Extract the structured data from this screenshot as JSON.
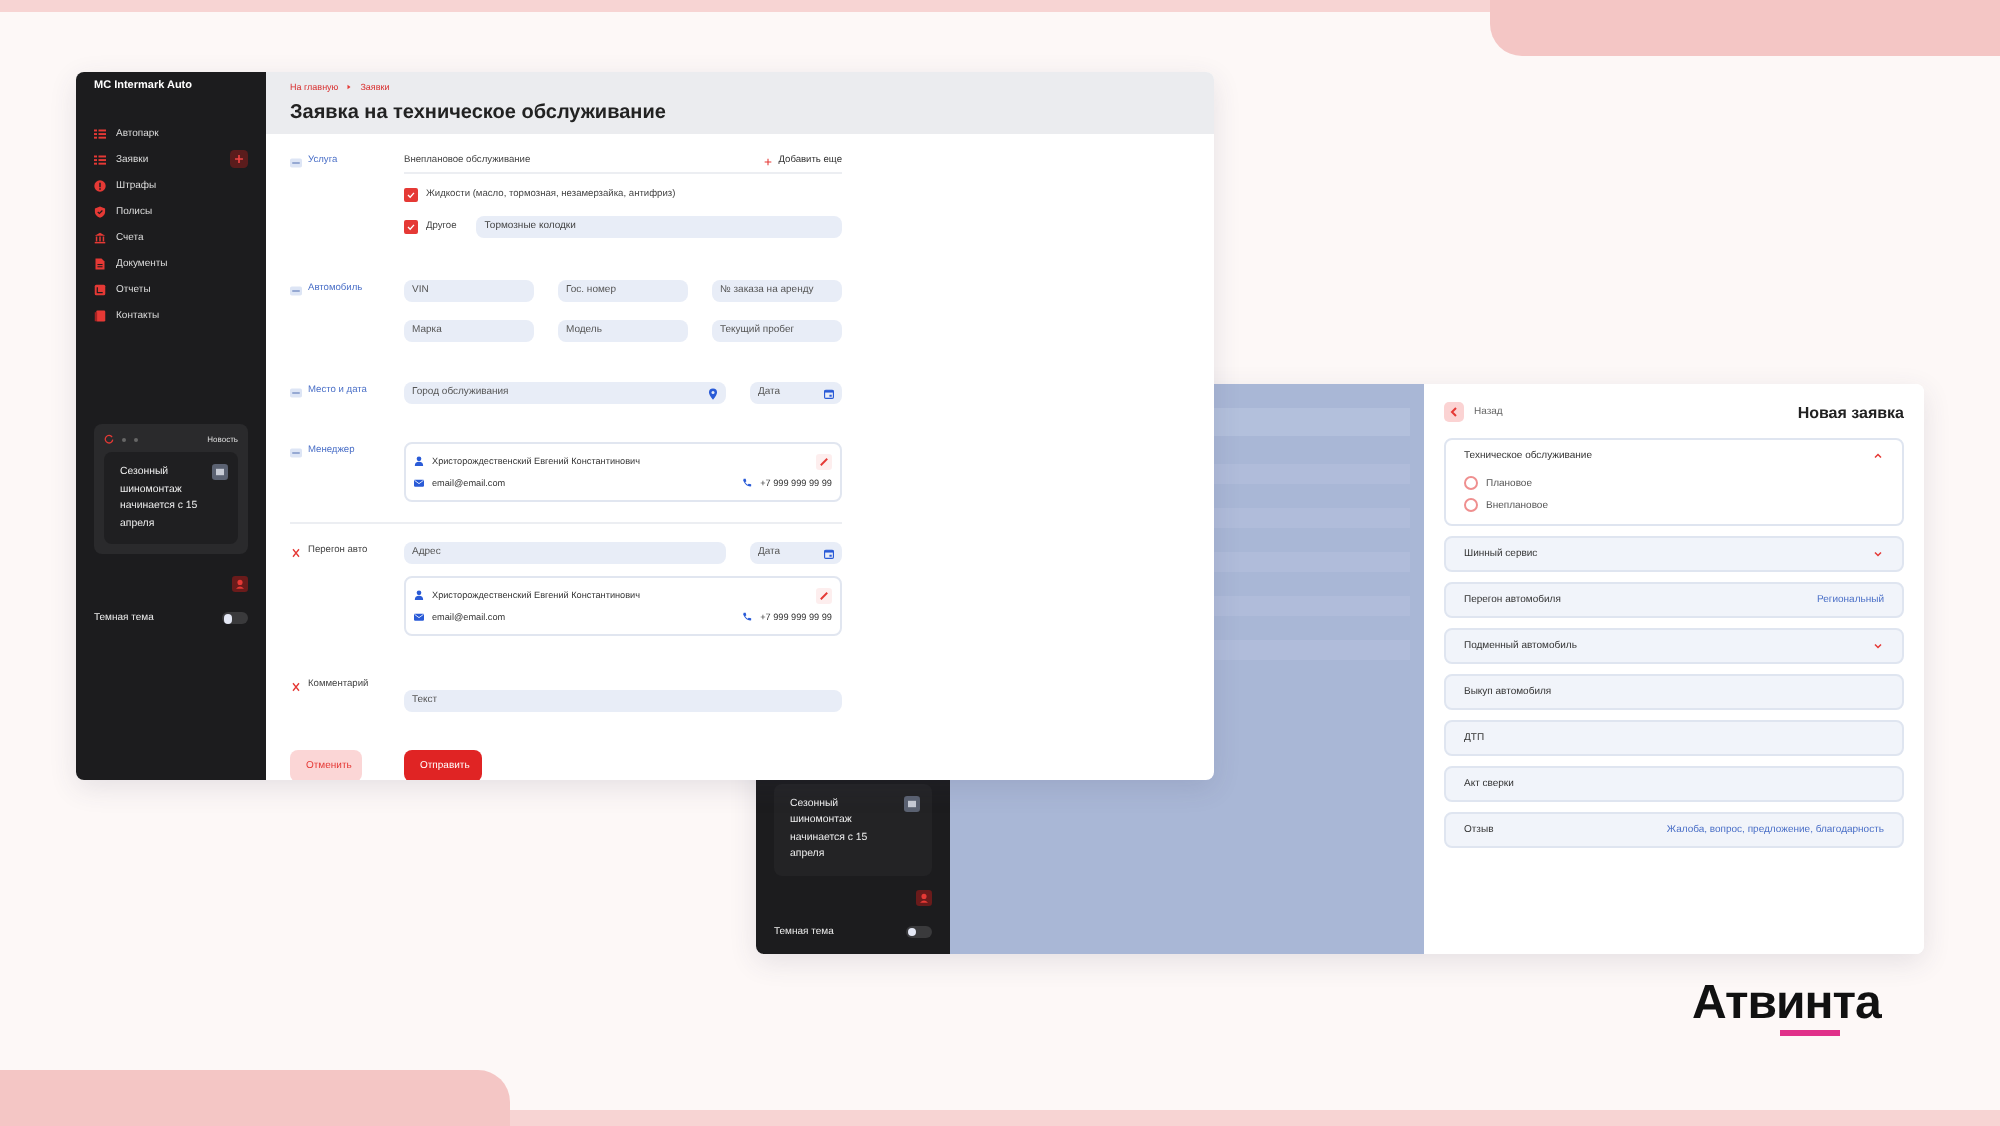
{
  "front_window": {
    "sidebar": {
      "brand": "MC Intermark Auto",
      "items": [
        {
          "label": "Автопарк"
        },
        {
          "label": "Заявки"
        },
        {
          "label": "Штрафы"
        },
        {
          "label": "Полисы"
        },
        {
          "label": "Счета"
        },
        {
          "label": "Документы"
        },
        {
          "label": "Отчеты"
        },
        {
          "label": "Контакты"
        }
      ],
      "news": {
        "label": "Новость",
        "text": "Сезонный шиномонтаж начинается с 15 апреля"
      },
      "dark_theme": {
        "label": "Темная тема",
        "on": false
      }
    },
    "breadcrumbs": [
      "На главную",
      "Заявки"
    ],
    "title": "Заявка на техническое обслуживание",
    "service": {
      "label": "Услуга",
      "kind": "fixed",
      "value": "Внеплановое обслуживание",
      "add": "Добавить еще",
      "options": [
        {
          "label": "Жидкости (масло, тормозная, незамерзайка, антифриз)",
          "checked": true
        },
        {
          "label": "Другое",
          "checked": true,
          "value": "Тормозные колодки"
        }
      ]
    },
    "car": {
      "label": "Автомобиль",
      "kind": "fixed",
      "fields": [
        {
          "placeholder": "VIN"
        },
        {
          "placeholder": "Гос. номер"
        },
        {
          "placeholder": "№ заказа на аренду"
        },
        {
          "placeholder": "Марка"
        },
        {
          "placeholder": "Модель"
        },
        {
          "placeholder": "Текущий пробег"
        }
      ]
    },
    "place": {
      "label": "Место и дата",
      "kind": "fixed",
      "city": {
        "placeholder": "Город обслуживания"
      },
      "date": {
        "placeholder": "Дата"
      }
    },
    "manager": {
      "label": "Менеджер",
      "kind": "fixed",
      "contact": {
        "name": "Христорождественский Евгений Константинович",
        "email": "email@email.com",
        "phone": "+7 999 999 99 99"
      }
    },
    "transfer": {
      "label": "Перегон авто",
      "kind": "removable",
      "address": {
        "placeholder": "Адрес"
      },
      "date": {
        "placeholder": "Дата"
      },
      "contact": {
        "name": "Христорождественский Евгений Константинович",
        "email": "email@email.com",
        "phone": "+7 999 999 99 99"
      }
    },
    "comment": {
      "label": "Комментарий",
      "kind": "removable",
      "field": {
        "placeholder": "Текст"
      }
    },
    "buttons": {
      "cancel": "Отменить",
      "submit": "Отправить"
    }
  },
  "back_window": {
    "news_text": "Сезонный шиномонтаж начинается с 15 апреля",
    "dark_theme": {
      "label": "Темная тема",
      "on": false
    },
    "back": "Назад",
    "title": "Новая заявка",
    "sections": [
      {
        "title": "Техническое обслуживание",
        "kind": "dropdown",
        "expanded": true,
        "options": [
          {
            "label": "Плановое",
            "selected": false
          },
          {
            "label": "Внеплановое",
            "selected": false
          }
        ]
      },
      {
        "title": "Шинный сервис",
        "kind": "dropdown",
        "expanded": false
      },
      {
        "title": "Перегон автомобиля",
        "kind": "note",
        "note": "Региональный"
      },
      {
        "title": "Подменный автомобиль",
        "kind": "dropdown",
        "expanded": false
      },
      {
        "title": "Выкуп автомобиля",
        "kind": "plain"
      },
      {
        "title": "ДТП",
        "kind": "plain"
      },
      {
        "title": "Акт сверки",
        "kind": "plain"
      },
      {
        "title": "Отзыв",
        "kind": "note",
        "note": "Жалоба, вопрос, предложение, благодарность"
      }
    ]
  },
  "logo": "Атвинта"
}
